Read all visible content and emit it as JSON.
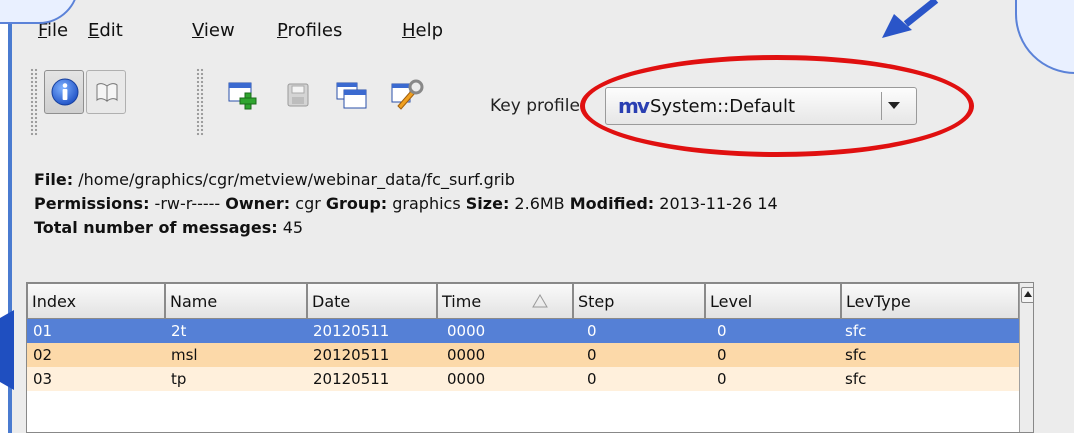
{
  "menubar": {
    "items": [
      {
        "label": "File",
        "underline": "F",
        "rest": "ile"
      },
      {
        "label": "Edit",
        "underline": "E",
        "rest": "dit"
      },
      {
        "label": "View",
        "underline": "V",
        "rest": "iew"
      },
      {
        "label": "Profiles",
        "underline": "P",
        "rest": "rofiles"
      },
      {
        "label": "Help",
        "underline": "H",
        "rest": "elp"
      }
    ]
  },
  "toolbar": {
    "key_profile_label": "Key profile:",
    "key_profile_value": "System::Default"
  },
  "info": {
    "file_label": "File:",
    "file_value": " /home/graphics/cgr/metview/webinar_data/fc_surf.grib",
    "permissions_label": "Permissions:",
    "permissions_value": " -rw-r----- ",
    "owner_label": "Owner:",
    "owner_value": " cgr ",
    "group_label": "Group:",
    "group_value": " graphics ",
    "size_label": "Size:",
    "size_value": " 2.6MB ",
    "modified_label": "Modified:",
    "modified_value": " 2013-11-26 14",
    "total_label": "Total number of messages:",
    "total_value": " 45"
  },
  "table": {
    "columns": [
      "Index",
      "Name",
      "Date",
      "Time",
      "Step",
      "Level",
      "LevType"
    ],
    "rows": [
      [
        "01",
        "2t",
        "20120511",
        "0000",
        "0",
        "0",
        "sfc"
      ],
      [
        "02",
        "msl",
        "20120511",
        "0000",
        "0",
        "0",
        "sfc"
      ],
      [
        "03",
        "tp",
        "20120511",
        "0000",
        "0",
        "0",
        "sfc"
      ]
    ]
  },
  "colors": {
    "selection": "#5580d6",
    "row_alt": "#fcd9a9",
    "highlight_ellipse": "#e01010",
    "callout": "#2a55c8"
  }
}
